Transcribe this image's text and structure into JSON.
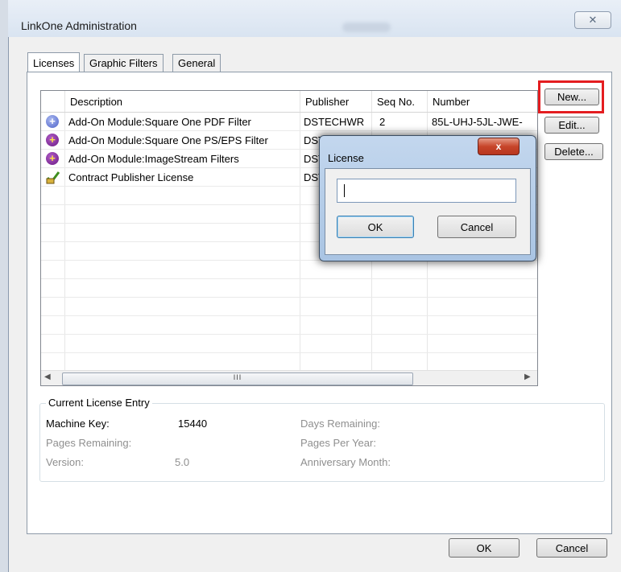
{
  "window": {
    "title": "LinkOne Administration",
    "close_glyph": "✕"
  },
  "tabs": [
    {
      "label": "Licenses",
      "active": true
    },
    {
      "label": "Graphic Filters",
      "active": false
    },
    {
      "label": "General",
      "active": false
    }
  ],
  "list": {
    "columns": [
      "Description",
      "Publisher",
      "Seq No.",
      "Number"
    ],
    "rows": [
      {
        "icon": "blue-plus-icon",
        "description": "Add-On Module:Square One PDF Filter",
        "publisher": "DSTECHWR",
        "seq": "2",
        "number": "85L-UHJ-5JL-JWE-"
      },
      {
        "icon": "purple-plus-icon",
        "description": "Add-On Module:Square One PS/EPS Filter",
        "publisher": "DST",
        "seq": "",
        "number": ""
      },
      {
        "icon": "purple-plus-icon",
        "description": "Add-On Module:ImageStream Filters",
        "publisher": "DST",
        "seq": "",
        "number": ""
      },
      {
        "icon": "certificate-icon",
        "description": "Contract Publisher License",
        "publisher": "DST",
        "seq": "",
        "number": ""
      }
    ],
    "scroll_thumb_glyph": "III"
  },
  "side_buttons": {
    "new": "New...",
    "edit": "Edit...",
    "delete": "Delete..."
  },
  "current_entry": {
    "legend": "Current License Entry",
    "machine_key_label": "Machine Key:",
    "machine_key_value": "15440",
    "days_remaining_label": "Days Remaining:",
    "pages_remaining_label": "Pages Remaining:",
    "pages_per_year_label": "Pages Per Year:",
    "version_label": "Version:",
    "version_value": "5.0",
    "anniversary_label": "Anniversary Month:"
  },
  "footer": {
    "ok": "OK",
    "cancel": "Cancel"
  },
  "license_dialog": {
    "title": "License",
    "close_glyph": "x",
    "input_value": "",
    "ok": "OK",
    "cancel": "Cancel"
  },
  "colors": {
    "highlight": "#e41d20",
    "titlebar": "#dfe8f3",
    "dialog_frame": "#b6cde8"
  }
}
